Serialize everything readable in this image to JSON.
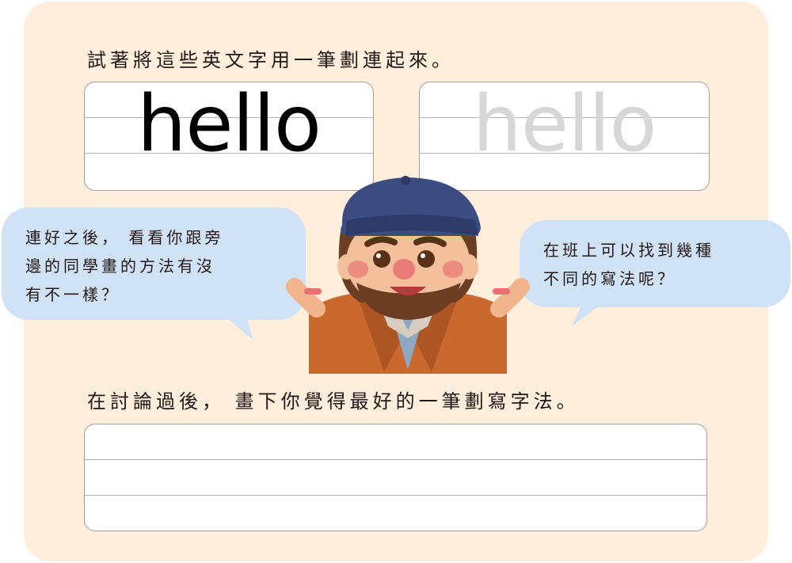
{
  "instructions": {
    "top": "試著將這些英文字用一筆劃連起來。",
    "bottom": "在討論過後， 畫下你覺得最好的一筆劃寫字法。"
  },
  "practice": {
    "example_word": "hello",
    "trace_word": "hello"
  },
  "bubbles": {
    "left_line1": "連好之後， 看看你跟旁",
    "left_line2": "邊的同學畫的方法有沒",
    "left_line3": "有不一樣？",
    "right_line1": "在班上可以找到幾種",
    "right_line2": "不同的寫法呢？"
  },
  "colors": {
    "card_bg": "#ffeedc",
    "bubble_bg": "#cfe2f6",
    "trace_gray": "#d7d7d7"
  }
}
